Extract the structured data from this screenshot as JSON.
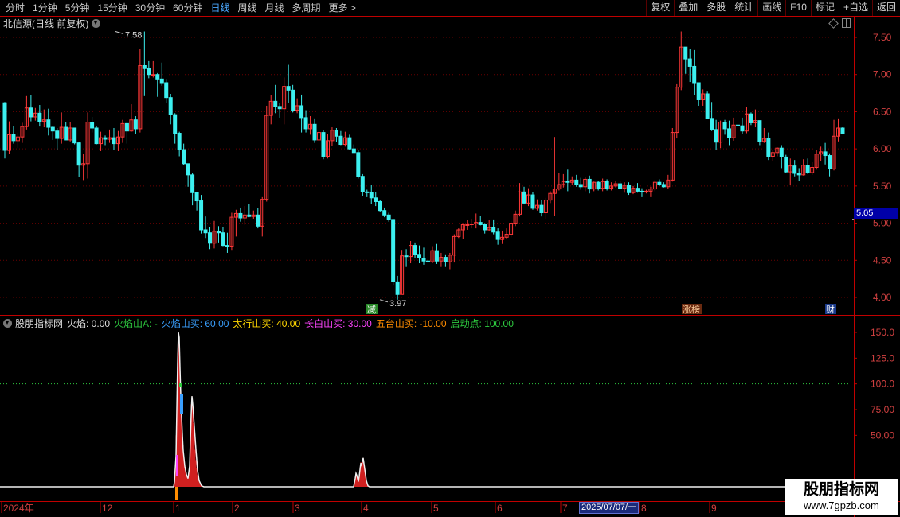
{
  "toolbar": {
    "periods": [
      "分时",
      "1分钟",
      "5分钟",
      "15分钟",
      "30分钟",
      "60分钟",
      "日线",
      "周线",
      "月线",
      "多周期",
      "更多 >"
    ],
    "active_period": "日线",
    "actions": [
      "复权",
      "叠加",
      "多股",
      "统计",
      "画线",
      "F10",
      "标记",
      "+自选",
      "返回"
    ]
  },
  "main_panel": {
    "title": "北信源(日线 前复权)",
    "price_axis": [
      "7.50",
      "7.00",
      "6.50",
      "6.00",
      "5.50",
      "5.00",
      "4.50",
      "4.00"
    ],
    "high_label": "7.58",
    "low_label": "3.97",
    "current_price": "5.05",
    "markers": [
      {
        "text": "减",
        "bg": "#2a8a2a",
        "color": "#ffffff"
      },
      {
        "text": "涨榜",
        "bg": "#6a2a10",
        "color": "#ffd0a0"
      },
      {
        "text": "财",
        "bg": "#1a3a8a",
        "color": "#ffffff"
      }
    ],
    "candles": [
      [
        6.62,
        6.63,
        5.87,
        5.98
      ],
      [
        5.98,
        6.37,
        5.93,
        6.19
      ],
      [
        6.19,
        6.31,
        6.07,
        6.11
      ],
      [
        6.11,
        6.22,
        6.01,
        6.16
      ],
      [
        6.16,
        6.35,
        6.08,
        6.3
      ],
      [
        6.3,
        6.71,
        6.26,
        6.55
      ],
      [
        6.55,
        6.72,
        6.37,
        6.43
      ],
      [
        6.43,
        6.55,
        6.38,
        6.48
      ],
      [
        6.48,
        6.59,
        6.3,
        6.37
      ],
      [
        6.37,
        6.53,
        6.29,
        6.39
      ],
      [
        6.39,
        6.54,
        6.18,
        6.29
      ],
      [
        6.29,
        6.3,
        6.12,
        6.24
      ],
      [
        6.24,
        6.28,
        5.99,
        6.14
      ],
      [
        6.14,
        6.49,
        6.07,
        6.29
      ],
      [
        6.29,
        6.36,
        6.12,
        6.12
      ],
      [
        6.12,
        6.36,
        6.1,
        6.28
      ],
      [
        6.28,
        6.28,
        6.06,
        6.08
      ],
      [
        6.08,
        6.09,
        5.62,
        5.78
      ],
      [
        5.78,
        5.93,
        5.58,
        5.8
      ],
      [
        5.8,
        6.49,
        5.6,
        6.36
      ],
      [
        6.36,
        6.43,
        6.22,
        6.28
      ],
      [
        6.28,
        6.31,
        6.06,
        6.07
      ],
      [
        6.07,
        6.23,
        5.97,
        6.15
      ],
      [
        6.15,
        6.18,
        6.05,
        6.13
      ],
      [
        6.13,
        6.26,
        6.08,
        6.15
      ],
      [
        6.15,
        6.28,
        5.99,
        6.07
      ],
      [
        6.07,
        6.24,
        5.97,
        6.16
      ],
      [
        6.16,
        6.39,
        6.08,
        6.34
      ],
      [
        6.34,
        6.35,
        6.07,
        6.24
      ],
      [
        6.24,
        6.6,
        6.23,
        6.39
      ],
      [
        6.39,
        6.44,
        6.2,
        6.27
      ],
      [
        6.27,
        7.35,
        6.22,
        7.12
      ],
      [
        7.12,
        7.58,
        6.71,
        7.08
      ],
      [
        7.08,
        7.18,
        6.95,
        7.0
      ],
      [
        7.0,
        7.18,
        6.96,
        7.0
      ],
      [
        7.0,
        7.02,
        6.7,
        6.94
      ],
      [
        6.94,
        7.16,
        6.85,
        6.89
      ],
      [
        6.89,
        6.94,
        6.62,
        6.69
      ],
      [
        6.69,
        6.74,
        6.33,
        6.46
      ],
      [
        6.46,
        6.48,
        6.07,
        6.21
      ],
      [
        6.21,
        6.23,
        5.9,
        5.99
      ],
      [
        5.99,
        6.07,
        5.78,
        5.8
      ],
      [
        5.8,
        5.8,
        5.49,
        5.65
      ],
      [
        5.65,
        5.68,
        5.24,
        5.41
      ],
      [
        5.41,
        5.41,
        5.17,
        5.3
      ],
      [
        5.3,
        5.38,
        4.86,
        4.91
      ],
      [
        4.91,
        5.09,
        4.8,
        4.87
      ],
      [
        4.87,
        4.95,
        4.65,
        4.73
      ],
      [
        4.73,
        5.03,
        4.66,
        4.89
      ],
      [
        4.89,
        4.96,
        4.74,
        4.87
      ],
      [
        4.87,
        4.95,
        4.69,
        4.7
      ],
      [
        4.7,
        4.87,
        4.6,
        4.69
      ],
      [
        4.69,
        5.14,
        4.64,
        5.08
      ],
      [
        5.08,
        5.18,
        4.82,
        5.13
      ],
      [
        5.13,
        5.21,
        5.02,
        5.07
      ],
      [
        5.07,
        5.23,
        4.98,
        5.11
      ],
      [
        5.11,
        5.26,
        5.08,
        5.09
      ],
      [
        5.09,
        5.17,
        5.06,
        5.11
      ],
      [
        5.11,
        5.2,
        4.93,
        4.96
      ],
      [
        4.96,
        5.35,
        4.82,
        5.32
      ],
      [
        5.32,
        6.58,
        5.29,
        6.45
      ],
      [
        6.45,
        6.72,
        6.33,
        6.64
      ],
      [
        6.64,
        6.86,
        6.48,
        6.57
      ],
      [
        6.57,
        6.62,
        6.42,
        6.54
      ],
      [
        6.54,
        6.96,
        6.33,
        6.84
      ],
      [
        6.84,
        7.13,
        6.62,
        6.79
      ],
      [
        6.79,
        6.86,
        6.49,
        6.52
      ],
      [
        6.52,
        6.68,
        6.48,
        6.58
      ],
      [
        6.58,
        6.73,
        6.22,
        6.42
      ],
      [
        6.42,
        6.52,
        6.22,
        6.27
      ],
      [
        6.27,
        6.44,
        6.19,
        6.33
      ],
      [
        6.33,
        6.41,
        6.08,
        6.12
      ],
      [
        6.12,
        6.34,
        6.07,
        6.22
      ],
      [
        6.22,
        6.25,
        5.86,
        5.9
      ],
      [
        5.9,
        6.2,
        5.87,
        6.11
      ],
      [
        6.11,
        6.29,
        6.04,
        6.25
      ],
      [
        6.25,
        6.28,
        6.09,
        6.17
      ],
      [
        6.17,
        6.24,
        6.05,
        6.06
      ],
      [
        6.06,
        6.23,
        6.03,
        6.15
      ],
      [
        6.15,
        6.19,
        5.98,
        6.0
      ],
      [
        6.0,
        6.06,
        5.95,
        5.95
      ],
      [
        5.95,
        5.98,
        5.6,
        5.63
      ],
      [
        5.63,
        5.66,
        5.36,
        5.42
      ],
      [
        5.42,
        5.45,
        5.35,
        5.41
      ],
      [
        5.41,
        5.52,
        5.26,
        5.34
      ],
      [
        5.34,
        5.42,
        5.23,
        5.29
      ],
      [
        5.29,
        5.31,
        5.15,
        5.17
      ],
      [
        5.17,
        5.21,
        5.08,
        5.11
      ],
      [
        5.11,
        5.14,
        5.02,
        5.05
      ],
      [
        5.05,
        5.06,
        4.17,
        4.21
      ],
      [
        4.21,
        4.29,
        3.97,
        4.04
      ],
      [
        4.04,
        4.64,
        4.04,
        4.56
      ],
      [
        4.56,
        4.65,
        4.41,
        4.55
      ],
      [
        4.55,
        4.76,
        4.46,
        4.7
      ],
      [
        4.7,
        4.74,
        4.53,
        4.58
      ],
      [
        4.58,
        4.7,
        4.46,
        4.53
      ],
      [
        4.53,
        4.67,
        4.44,
        4.49
      ],
      [
        4.49,
        4.55,
        4.46,
        4.48
      ],
      [
        4.48,
        4.69,
        4.46,
        4.63
      ],
      [
        4.63,
        4.72,
        4.45,
        4.49
      ],
      [
        4.49,
        4.6,
        4.41,
        4.54
      ],
      [
        4.54,
        4.58,
        4.41,
        4.48
      ],
      [
        4.48,
        4.6,
        4.38,
        4.57
      ],
      [
        4.57,
        4.85,
        4.47,
        4.82
      ],
      [
        4.82,
        4.93,
        4.8,
        4.91
      ],
      [
        4.91,
        5.0,
        4.79,
        4.98
      ],
      [
        4.98,
        5.04,
        4.91,
        4.98
      ],
      [
        4.98,
        5.06,
        4.93,
        4.99
      ],
      [
        4.99,
        5.13,
        4.93,
        5.01
      ],
      [
        5.01,
        5.1,
        4.97,
        4.98
      ],
      [
        4.98,
        5.0,
        4.86,
        4.91
      ],
      [
        4.91,
        5.04,
        4.89,
        4.94
      ],
      [
        4.94,
        5.05,
        4.85,
        4.88
      ],
      [
        4.88,
        4.93,
        4.71,
        4.78
      ],
      [
        4.78,
        4.9,
        4.72,
        4.81
      ],
      [
        4.81,
        4.93,
        4.79,
        4.85
      ],
      [
        4.85,
        5.03,
        4.81,
        5.0
      ],
      [
        5.0,
        5.17,
        4.96,
        5.12
      ],
      [
        5.12,
        5.54,
        5.09,
        5.42
      ],
      [
        5.42,
        5.49,
        5.26,
        5.27
      ],
      [
        5.27,
        5.47,
        5.23,
        5.38
      ],
      [
        5.38,
        5.42,
        5.18,
        5.2
      ],
      [
        5.2,
        5.32,
        5.17,
        5.24
      ],
      [
        5.24,
        5.31,
        5.09,
        5.14
      ],
      [
        5.14,
        5.34,
        5.06,
        5.31
      ],
      [
        5.31,
        5.43,
        5.27,
        5.4
      ],
      [
        5.4,
        6.16,
        5.1,
        5.46
      ],
      [
        5.46,
        5.67,
        5.44,
        5.52
      ],
      [
        5.52,
        5.66,
        5.48,
        5.56
      ],
      [
        5.56,
        5.72,
        5.43,
        5.55
      ],
      [
        5.55,
        5.63,
        5.52,
        5.58
      ],
      [
        5.58,
        5.65,
        5.49,
        5.52
      ],
      [
        5.52,
        5.61,
        5.45,
        5.49
      ],
      [
        5.49,
        5.62,
        5.43,
        5.59
      ],
      [
        5.59,
        5.64,
        5.4,
        5.46
      ],
      [
        5.46,
        5.56,
        5.43,
        5.55
      ],
      [
        5.55,
        5.57,
        5.44,
        5.47
      ],
      [
        5.47,
        5.6,
        5.43,
        5.56
      ],
      [
        5.56,
        5.59,
        5.44,
        5.47
      ],
      [
        5.47,
        5.55,
        5.44,
        5.5
      ],
      [
        5.5,
        5.57,
        5.48,
        5.53
      ],
      [
        5.53,
        5.57,
        5.46,
        5.47
      ],
      [
        5.47,
        5.55,
        5.41,
        5.51
      ],
      [
        5.51,
        5.55,
        5.38,
        5.41
      ],
      [
        5.41,
        5.5,
        5.39,
        5.47
      ],
      [
        5.47,
        5.54,
        5.41,
        5.43
      ],
      [
        5.43,
        5.47,
        5.35,
        5.42
      ],
      [
        5.42,
        5.45,
        5.4,
        5.43
      ],
      [
        5.43,
        5.49,
        5.35,
        5.46
      ],
      [
        5.46,
        5.58,
        5.43,
        5.55
      ],
      [
        5.55,
        5.59,
        5.5,
        5.52
      ],
      [
        5.52,
        5.55,
        5.48,
        5.49
      ],
      [
        5.49,
        5.65,
        5.46,
        5.58
      ],
      [
        5.58,
        6.28,
        5.56,
        6.22
      ],
      [
        6.22,
        6.88,
        6.14,
        6.83
      ],
      [
        6.83,
        7.58,
        6.79,
        7.37
      ],
      [
        7.37,
        7.37,
        7.01,
        7.21
      ],
      [
        7.21,
        7.34,
        6.9,
        7.11
      ],
      [
        7.11,
        7.33,
        6.72,
        6.89
      ],
      [
        6.89,
        6.89,
        6.58,
        6.66
      ],
      [
        6.66,
        6.8,
        6.58,
        6.74
      ],
      [
        6.74,
        6.77,
        6.41,
        6.41
      ],
      [
        6.41,
        6.63,
        6.24,
        6.26
      ],
      [
        6.26,
        6.39,
        5.99,
        6.09
      ],
      [
        6.09,
        6.38,
        6.01,
        6.36
      ],
      [
        6.36,
        6.39,
        6.19,
        6.27
      ],
      [
        6.27,
        6.38,
        6.05,
        6.15
      ],
      [
        6.15,
        6.42,
        6.11,
        6.32
      ],
      [
        6.32,
        6.5,
        6.23,
        6.31
      ],
      [
        6.31,
        6.42,
        6.2,
        6.24
      ],
      [
        6.24,
        6.56,
        6.21,
        6.47
      ],
      [
        6.47,
        6.49,
        6.32,
        6.35
      ],
      [
        6.35,
        6.53,
        6.29,
        6.38
      ],
      [
        6.38,
        6.38,
        6.05,
        6.1
      ],
      [
        6.1,
        6.28,
        6.08,
        6.14
      ],
      [
        6.14,
        6.22,
        5.85,
        5.9
      ],
      [
        5.9,
        5.98,
        5.84,
        5.95
      ],
      [
        5.95,
        6.02,
        5.9,
        6.01
      ],
      [
        6.01,
        6.05,
        5.74,
        5.89
      ],
      [
        5.89,
        5.92,
        5.67,
        5.69
      ],
      [
        5.69,
        5.87,
        5.51,
        5.77
      ],
      [
        5.77,
        5.85,
        5.63,
        5.67
      ],
      [
        5.67,
        5.74,
        5.57,
        5.65
      ],
      [
        5.65,
        5.86,
        5.64,
        5.78
      ],
      [
        5.78,
        5.87,
        5.66,
        5.68
      ],
      [
        5.68,
        5.82,
        5.65,
        5.75
      ],
      [
        5.75,
        5.98,
        5.72,
        5.93
      ],
      [
        5.93,
        6.03,
        5.83,
        5.96
      ],
      [
        5.96,
        6.08,
        5.79,
        5.91
      ],
      [
        5.91,
        5.94,
        5.63,
        5.73
      ],
      [
        5.73,
        6.39,
        5.71,
        6.17
      ],
      [
        6.17,
        6.41,
        6.1,
        6.28
      ],
      [
        6.28,
        6.29,
        6.2,
        6.2
      ]
    ],
    "current_line_price": 5.05
  },
  "indicator_panel": {
    "name": "股朋指标网",
    "items": [
      {
        "text": "火焰: 0.00",
        "color": "#e0e0e0"
      },
      {
        "text": "火焰山A: -",
        "color": "#2ecc40"
      },
      {
        "text": "火焰山买: 60.00",
        "color": "#3aa0ff"
      },
      {
        "text": "太行山买: 40.00",
        "color": "#ffd700"
      },
      {
        "text": "长白山买: 30.00",
        "color": "#ff44ff"
      },
      {
        "text": "五台山买: -10.00",
        "color": "#ff8c00"
      },
      {
        "text": "启动点: 100.00",
        "color": "#2ecc40"
      }
    ],
    "axis": [
      "150.0",
      "125.0",
      "100.0",
      "75.00",
      "50.00"
    ],
    "reference_level": 100,
    "ymax": 160,
    "histogram": [
      [
        219,
        6
      ],
      [
        220,
        18
      ],
      [
        221,
        50
      ],
      [
        222,
        82
      ],
      [
        223,
        130
      ],
      [
        224,
        150
      ],
      [
        225,
        140
      ],
      [
        226,
        120
      ],
      [
        227,
        95
      ],
      [
        228,
        72
      ],
      [
        229,
        55
      ],
      [
        230,
        40
      ],
      [
        231,
        28
      ],
      [
        232,
        22
      ],
      [
        233,
        17
      ],
      [
        234,
        13
      ],
      [
        235,
        10
      ],
      [
        236,
        8
      ],
      [
        237,
        12
      ],
      [
        238,
        26
      ],
      [
        239,
        50
      ],
      [
        240,
        80
      ],
      [
        241,
        88
      ],
      [
        242,
        78
      ],
      [
        243,
        62
      ],
      [
        244,
        48
      ],
      [
        245,
        36
      ],
      [
        246,
        26
      ],
      [
        247,
        18
      ],
      [
        248,
        12
      ],
      [
        249,
        8
      ],
      [
        250,
        5
      ],
      [
        251,
        3
      ],
      [
        252,
        2
      ],
      [
        253,
        1
      ],
      [
        445,
        4
      ],
      [
        446,
        9
      ],
      [
        447,
        13
      ],
      [
        448,
        10
      ],
      [
        449,
        7
      ],
      [
        450,
        5
      ],
      [
        451,
        11
      ],
      [
        452,
        19
      ],
      [
        453,
        24
      ],
      [
        454,
        21
      ],
      [
        455,
        26
      ],
      [
        456,
        28
      ],
      [
        457,
        22
      ],
      [
        458,
        16
      ],
      [
        459,
        10
      ],
      [
        460,
        7
      ],
      [
        461,
        4
      ],
      [
        462,
        2
      ]
    ],
    "curve": [
      [
        0,
        0
      ],
      [
        218,
        0
      ],
      [
        219,
        5
      ],
      [
        221,
        30
      ],
      [
        222,
        75
      ],
      [
        223,
        120
      ],
      [
        224,
        150
      ],
      [
        225,
        145
      ],
      [
        226,
        115
      ],
      [
        227,
        88
      ],
      [
        228,
        68
      ],
      [
        229,
        50
      ],
      [
        230,
        35
      ],
      [
        232,
        20
      ],
      [
        234,
        12
      ],
      [
        236,
        8
      ],
      [
        238,
        20
      ],
      [
        240,
        70
      ],
      [
        241,
        88
      ],
      [
        242,
        80
      ],
      [
        244,
        58
      ],
      [
        246,
        36
      ],
      [
        248,
        16
      ],
      [
        250,
        6
      ],
      [
        253,
        1
      ],
      [
        256,
        0
      ],
      [
        444,
        0
      ],
      [
        446,
        8
      ],
      [
        447,
        13
      ],
      [
        448,
        11
      ],
      [
        450,
        5
      ],
      [
        451,
        10
      ],
      [
        453,
        23
      ],
      [
        454,
        21
      ],
      [
        456,
        28
      ],
      [
        458,
        17
      ],
      [
        460,
        6
      ],
      [
        462,
        1
      ],
      [
        464,
        0
      ],
      [
        985,
        0
      ]
    ],
    "orange_mark": "#ff8c00",
    "magenta_mark": "#ff44ff",
    "blue_mark": "#3aa0ff",
    "green_mark": "#2ecc40"
  },
  "time_axis": {
    "labels": [
      "2024年",
      "12",
      "1",
      "2",
      "3",
      "4",
      "5",
      "6",
      "7",
      "8",
      "9"
    ],
    "selected_date": "2025/07/07/一"
  },
  "watermark": {
    "title": "股朋指标网",
    "url": "www.7gpzb.com"
  },
  "colors": {
    "up": "#ff3838",
    "down": "#3cf0f0",
    "axis": "#c00000",
    "grid": "#6a0000",
    "bg": "#000000"
  }
}
